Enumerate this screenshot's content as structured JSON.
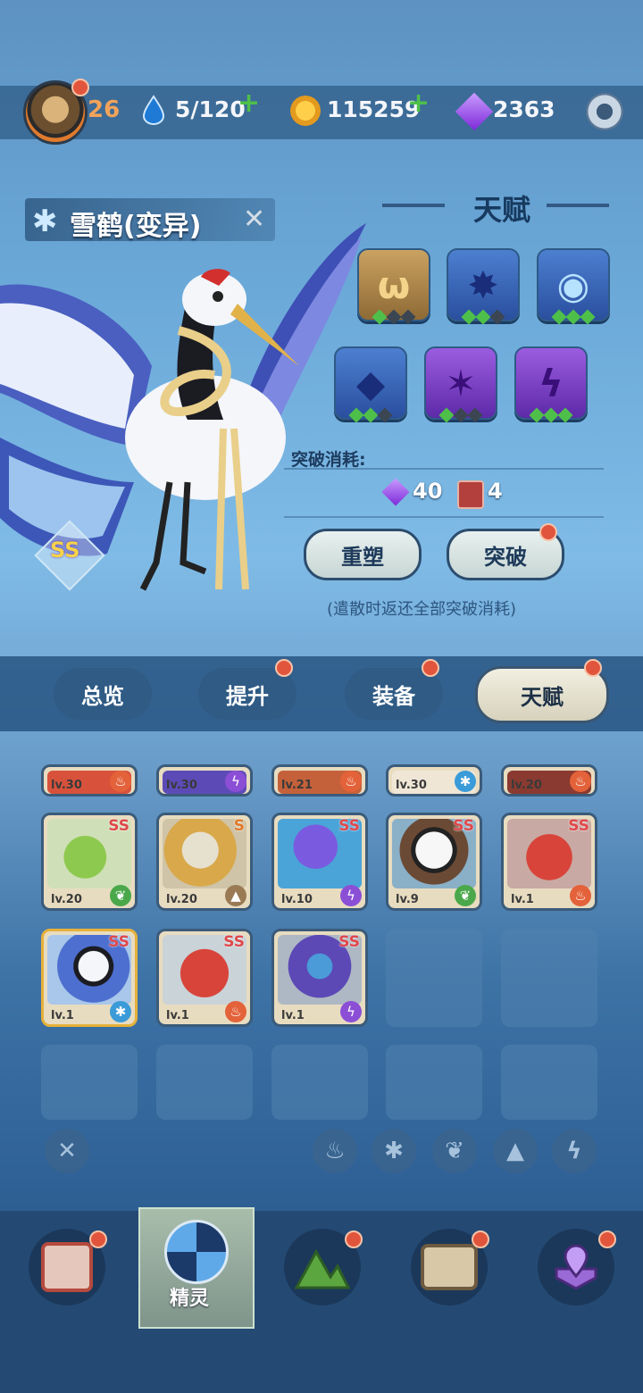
{
  "topbar": {
    "level": "26",
    "stamina": "5/120",
    "gold": "115259",
    "gems": "2363"
  },
  "creature": {
    "name": "雪鹤(变异)",
    "rank": "SS"
  },
  "talent": {
    "title": "天赋",
    "breakthrough_cost_label": "突破消耗:",
    "gem_cost": "40",
    "book_cost": "4",
    "reshape_label": "重塑",
    "breakthrough_label": "突破",
    "note": "(遣散时返还全部突破消耗)"
  },
  "tabs": [
    "总览",
    "提升",
    "装备",
    "天赋"
  ],
  "grid": {
    "top_row": [
      {
        "level": "lv.30",
        "element": "fire"
      },
      {
        "level": "lv.30",
        "element": "lightning"
      },
      {
        "level": "lv.21",
        "element": "fire"
      },
      {
        "level": "lv.30",
        "element": "ice"
      },
      {
        "level": "lv.20",
        "element": "fire"
      }
    ],
    "row2": [
      {
        "level": "lv.20",
        "rank": "SS",
        "element": "leaf"
      },
      {
        "level": "lv.20",
        "rank": "S",
        "element": "earth"
      },
      {
        "level": "lv.10",
        "rank": "SS",
        "element": "lightning"
      },
      {
        "level": "lv.9",
        "rank": "SS",
        "element": "leaf"
      },
      {
        "level": "lv.1",
        "rank": "SS",
        "element": "fire"
      }
    ],
    "row3": [
      {
        "level": "lv.1",
        "rank": "SS",
        "element": "ice"
      },
      {
        "level": "lv.1",
        "rank": "SS",
        "element": "fire"
      },
      {
        "level": "lv.1",
        "rank": "SS",
        "element": "lightning"
      }
    ]
  },
  "nav": {
    "selected_label": "精灵"
  },
  "colors": {
    "fire": "#e3623a",
    "lightning": "#8b4fd6",
    "ice": "#3a9bd8",
    "leaf": "#4aa84a",
    "earth": "#9a7a55"
  }
}
